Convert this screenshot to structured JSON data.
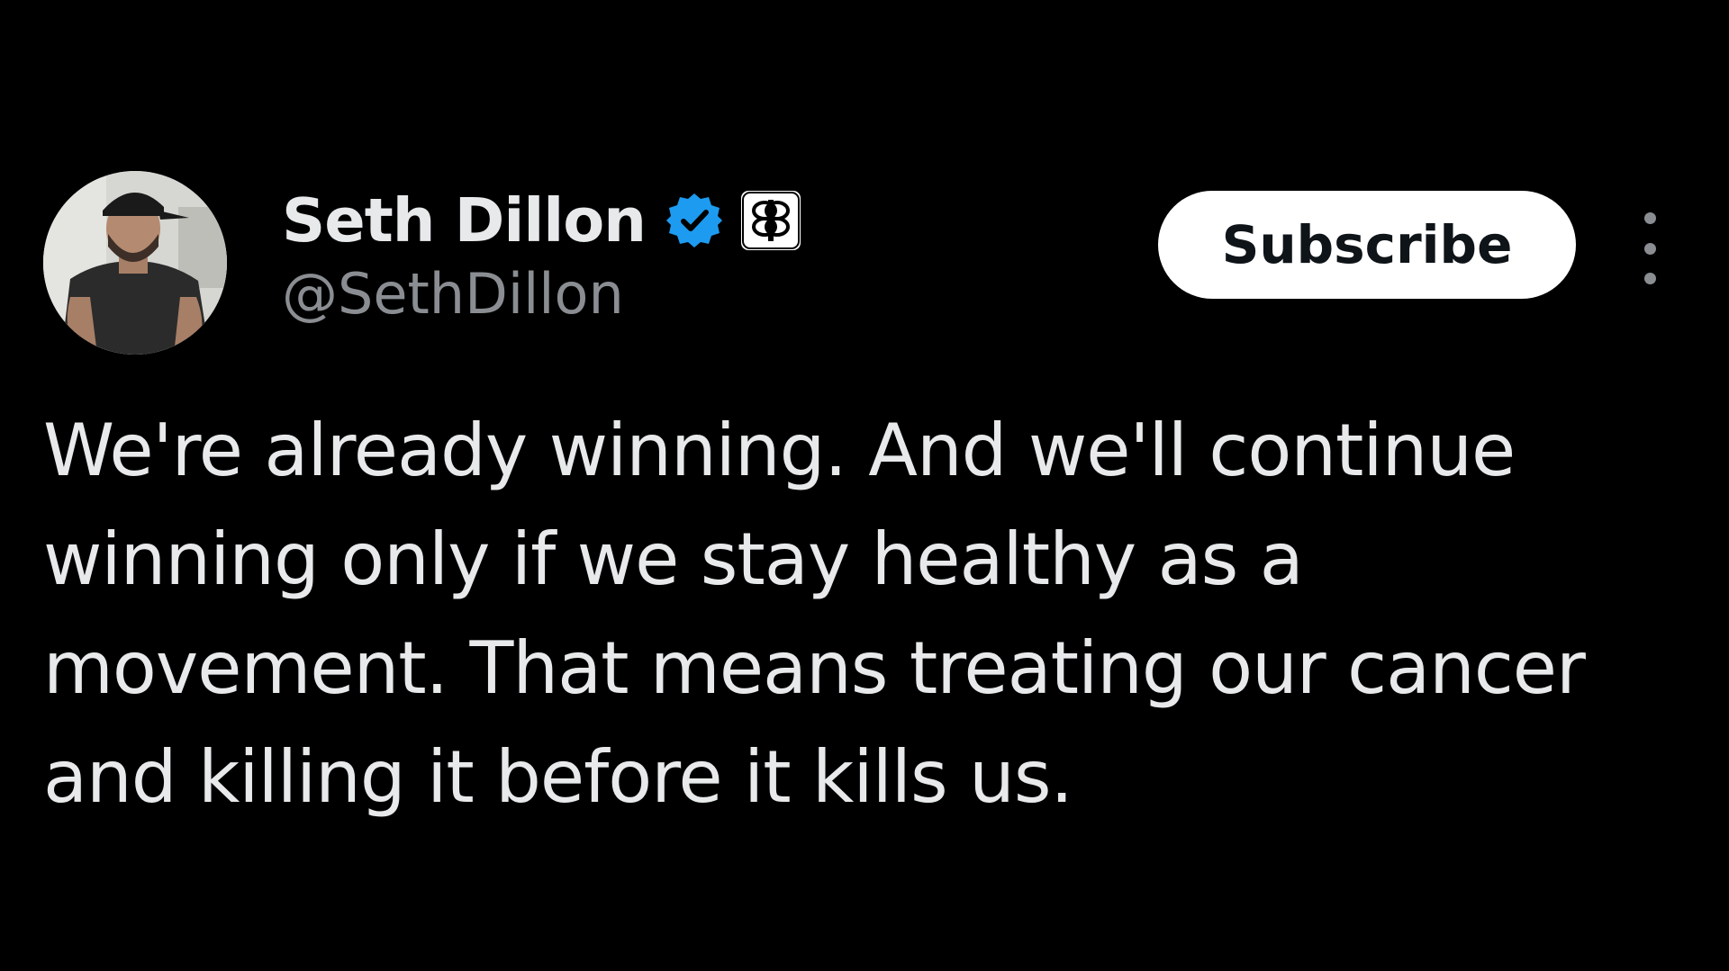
{
  "author": {
    "display_name": "Seth Dillon",
    "handle": "@SethDillon",
    "verified": true,
    "verified_badge_icon": "verified-check-icon",
    "affiliate_badge_icon": "babylon-bee-logo-icon"
  },
  "actions": {
    "subscribe_label": "Subscribe",
    "more_icon": "more-vertical-icon"
  },
  "tweet": {
    "lines": [
      "We're already winning. And we'll continue",
      "winning only if we stay healthy as a",
      "movement. That means treating our cancer",
      "and killing it before it kills us."
    ]
  },
  "colors": {
    "background": "#000000",
    "text_primary": "#e7e9ea",
    "text_secondary": "#8a8d91",
    "verified_blue": "#1d9bf0",
    "button_bg": "#ffffff",
    "button_text": "#0f1419"
  }
}
